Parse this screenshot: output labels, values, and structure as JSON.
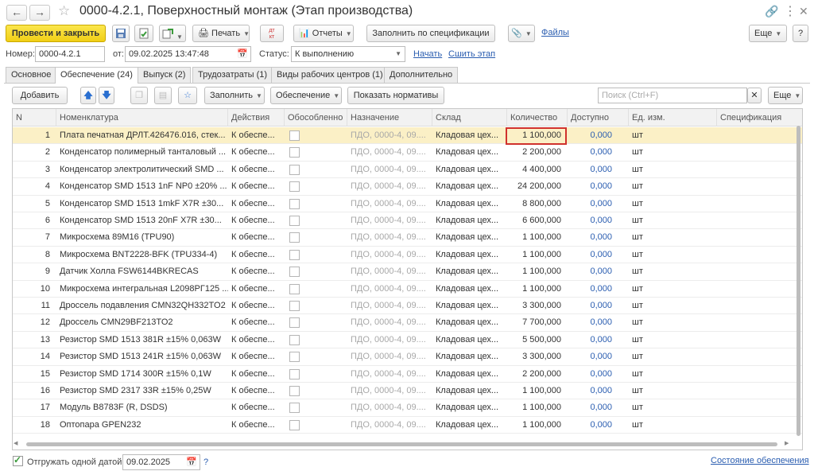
{
  "window": {
    "title": "0000-4.2.1, Поверхностный монтаж (Этап производства)"
  },
  "toolbar": {
    "post_close": "Провести и закрыть",
    "print": "Печать",
    "reports": "Отчеты",
    "fill_by_spec": "Заполнить по спецификации",
    "files": "Файлы",
    "more": "Еще"
  },
  "header": {
    "number_label": "Номер:",
    "number_value": "0000-4.2.1",
    "from_label": "от:",
    "date_value": "09.02.2025 13:47:48",
    "status_label": "Статус:",
    "status_value": "К выполнению",
    "start_link": "Начать",
    "split_link": "Сшить этап"
  },
  "tabs": [
    "Основное",
    "Обеспечение (24)",
    "Выпуск (2)",
    "Трудозатраты (1)",
    "Виды рабочих центров (1)",
    "Дополнительно"
  ],
  "subtoolbar": {
    "add": "Добавить",
    "fill": "Заполнить",
    "provision": "Обеспечение",
    "show_norms": "Показать нормативы",
    "search_placeholder": "Поиск (Ctrl+F)",
    "more": "Еще"
  },
  "grid": {
    "columns": [
      "N",
      "Номенклатура",
      "Действия",
      "Обособленно",
      "Назначение",
      "Склад",
      "Количество",
      "Доступно",
      "Ед. изм.",
      "Спецификация"
    ],
    "rows": [
      {
        "n": "1",
        "name": "Плата печатная ДРЛТ.426476.016, стек...",
        "action": "К обеспе...",
        "dest": "ПДО, 0000-4, 09....",
        "wh": "Кладовая цех...",
        "qty": "1 100,000",
        "avail": "0,000",
        "unit": "шт"
      },
      {
        "n": "2",
        "name": "Конденсатор полимерный танталовый ...",
        "action": "К обеспе...",
        "dest": "ПДО, 0000-4, 09....",
        "wh": "Кладовая цех...",
        "qty": "2 200,000",
        "avail": "0,000",
        "unit": "шт"
      },
      {
        "n": "3",
        "name": "Конденсатор электролитический SMD ...",
        "action": "К обеспе...",
        "dest": "ПДО, 0000-4, 09....",
        "wh": "Кладовая цех...",
        "qty": "4 400,000",
        "avail": "0,000",
        "unit": "шт"
      },
      {
        "n": "4",
        "name": "Конденсатор SMD 1513 1nF NP0 ±20% ...",
        "action": "К обеспе...",
        "dest": "ПДО, 0000-4, 09....",
        "wh": "Кладовая цех...",
        "qty": "24 200,000",
        "avail": "0,000",
        "unit": "шт"
      },
      {
        "n": "5",
        "name": "Конденсатор SMD 1513 1mkF X7R ±30...",
        "action": "К обеспе...",
        "dest": "ПДО, 0000-4, 09....",
        "wh": "Кладовая цех...",
        "qty": "8 800,000",
        "avail": "0,000",
        "unit": "шт"
      },
      {
        "n": "6",
        "name": "Конденсатор SMD 1513 20nF X7R ±30...",
        "action": "К обеспе...",
        "dest": "ПДО, 0000-4, 09....",
        "wh": "Кладовая цех...",
        "qty": "6 600,000",
        "avail": "0,000",
        "unit": "шт"
      },
      {
        "n": "7",
        "name": "Микросхема 89M16 (TPU90)",
        "action": "К обеспе...",
        "dest": "ПДО, 0000-4, 09....",
        "wh": "Кладовая цех...",
        "qty": "1 100,000",
        "avail": "0,000",
        "unit": "шт"
      },
      {
        "n": "8",
        "name": "Микросхема BNT2228-BFK (TPU334-4)",
        "action": "К обеспе...",
        "dest": "ПДО, 0000-4, 09....",
        "wh": "Кладовая цех...",
        "qty": "1 100,000",
        "avail": "0,000",
        "unit": "шт"
      },
      {
        "n": "9",
        "name": "Датчик Холла FSW6144BKRECAS",
        "action": "К обеспе...",
        "dest": "ПДО, 0000-4, 09....",
        "wh": "Кладовая цех...",
        "qty": "1 100,000",
        "avail": "0,000",
        "unit": "шт"
      },
      {
        "n": "10",
        "name": "Микросхема интегральная L2098РГ125 ...",
        "action": "К обеспе...",
        "dest": "ПДО, 0000-4, 09....",
        "wh": "Кладовая цех...",
        "qty": "1 100,000",
        "avail": "0,000",
        "unit": "шт"
      },
      {
        "n": "11",
        "name": "Дроссель подавления CMN32QH332TO2",
        "action": "К обеспе...",
        "dest": "ПДО, 0000-4, 09....",
        "wh": "Кладовая цех...",
        "qty": "3 300,000",
        "avail": "0,000",
        "unit": "шт"
      },
      {
        "n": "12",
        "name": "Дроссель CMN29BF213TO2",
        "action": "К обеспе...",
        "dest": "ПДО, 0000-4, 09....",
        "wh": "Кладовая цех...",
        "qty": "7 700,000",
        "avail": "0,000",
        "unit": "шт"
      },
      {
        "n": "13",
        "name": "Резистор SMD 1513 381R ±15% 0,063W",
        "action": "К обеспе...",
        "dest": "ПДО, 0000-4, 09....",
        "wh": "Кладовая цех...",
        "qty": "5 500,000",
        "avail": "0,000",
        "unit": "шт"
      },
      {
        "n": "14",
        "name": "Резистор SMD 1513 241R ±15% 0,063W",
        "action": "К обеспе...",
        "dest": "ПДО, 0000-4, 09....",
        "wh": "Кладовая цех...",
        "qty": "3 300,000",
        "avail": "0,000",
        "unit": "шт"
      },
      {
        "n": "15",
        "name": "Резистор SMD 1714 300R ±15% 0,1W",
        "action": "К обеспе...",
        "dest": "ПДО, 0000-4, 09....",
        "wh": "Кладовая цех...",
        "qty": "2 200,000",
        "avail": "0,000",
        "unit": "шт"
      },
      {
        "n": "16",
        "name": "Резистор SMD 2317 33R ±15% 0,25W",
        "action": "К обеспе...",
        "dest": "ПДО, 0000-4, 09....",
        "wh": "Кладовая цех...",
        "qty": "1 100,000",
        "avail": "0,000",
        "unit": "шт"
      },
      {
        "n": "17",
        "name": "Модуль B8783F (R, DSDS)",
        "action": "К обеспе...",
        "dest": "ПДО, 0000-4, 09....",
        "wh": "Кладовая цех...",
        "qty": "1 100,000",
        "avail": "0,000",
        "unit": "шт"
      },
      {
        "n": "18",
        "name": "Оптопара GPEN232",
        "action": "К обеспе...",
        "dest": "ПДО, 0000-4, 09....",
        "wh": "Кладовая цех...",
        "qty": "1 100,000",
        "avail": "0,000",
        "unit": "шт"
      }
    ]
  },
  "footer": {
    "ship_one_date": "Отгружать одной датой",
    "ship_date": "09.02.2025",
    "help": "?",
    "provision_status": "Состояние обеспечения"
  },
  "colors": {
    "primary_button": "#f1cf16",
    "selected_row": "#fbf0c6",
    "link": "#2a5db0",
    "highlight_border": "#d0312d"
  }
}
